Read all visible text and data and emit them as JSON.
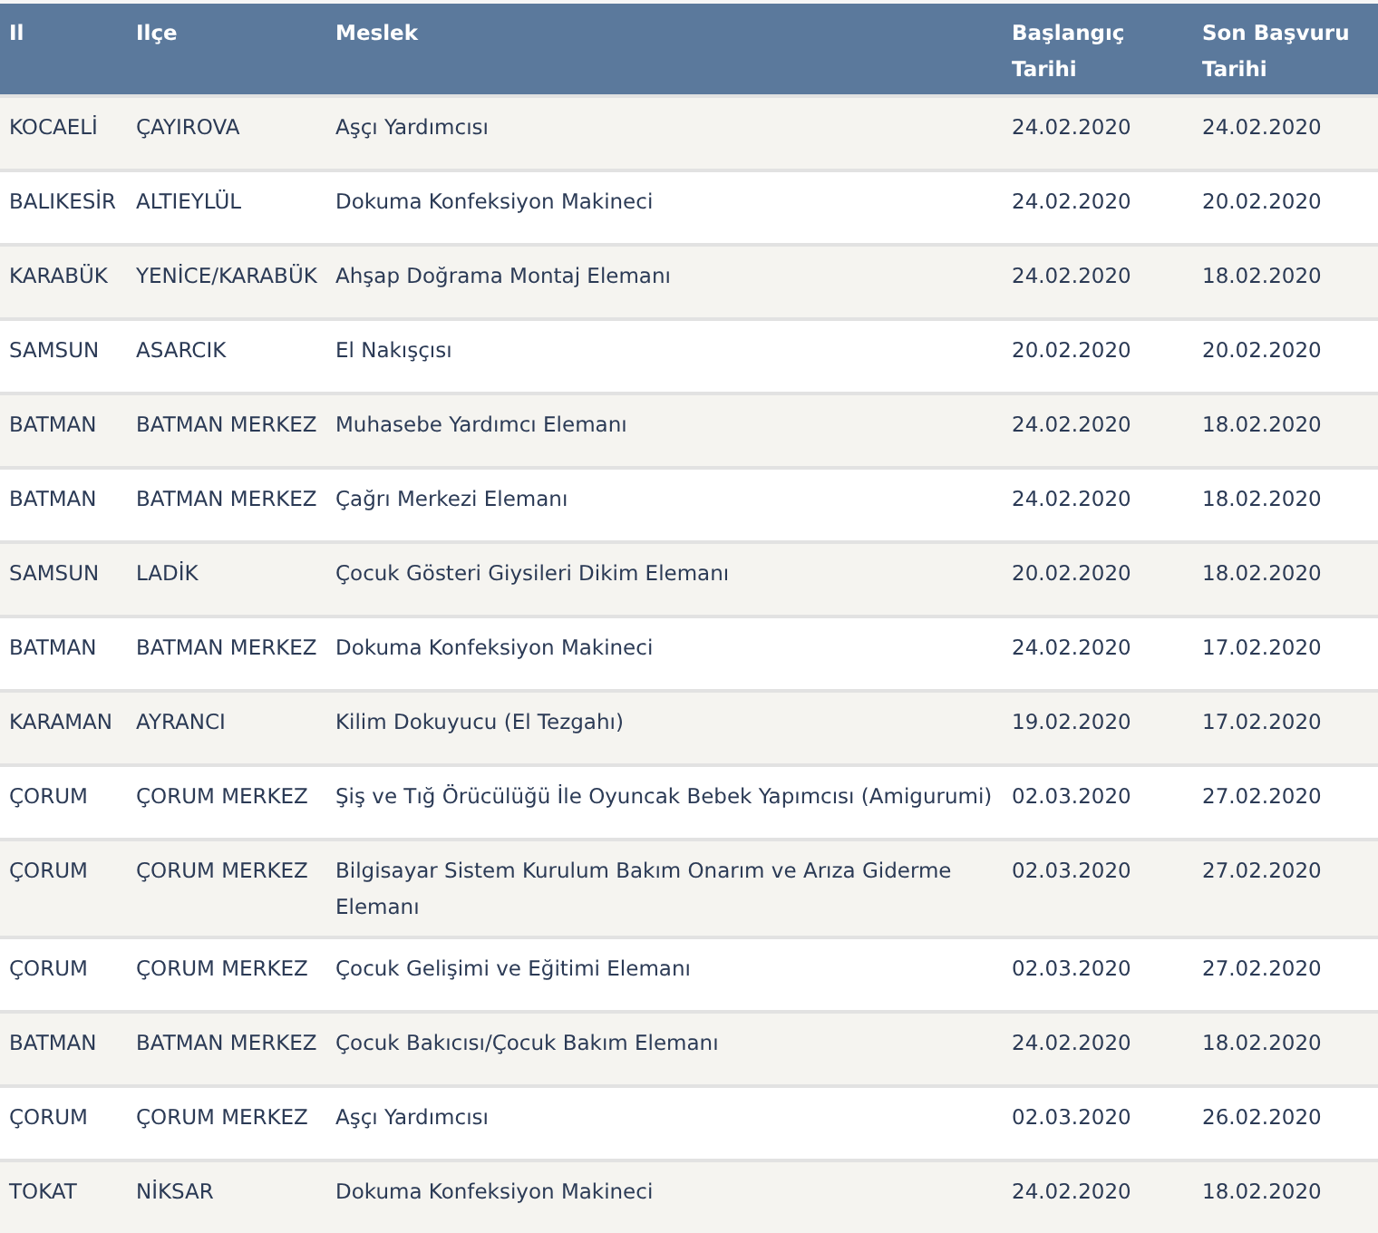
{
  "table": {
    "columns": [
      "Il",
      "Ilçe",
      "Meslek",
      "Başlangıç Tarihi",
      "Son Başvuru Tarihi"
    ],
    "rows": [
      [
        "KOCAELİ",
        "ÇAYIROVA",
        "Aşçı Yardımcısı",
        "24.02.2020",
        "24.02.2020"
      ],
      [
        "BALIKESİR",
        "ALTIEYLÜL",
        "Dokuma Konfeksiyon Makineci",
        "24.02.2020",
        "20.02.2020"
      ],
      [
        "KARABÜK",
        "YENİCE/KARABÜK",
        "Ahşap Doğrama Montaj Elemanı",
        "24.02.2020",
        "18.02.2020"
      ],
      [
        "SAMSUN",
        "ASARCIK",
        "El Nakışçısı",
        "20.02.2020",
        "20.02.2020"
      ],
      [
        "BATMAN",
        "BATMAN MERKEZ",
        "Muhasebe Yardımcı Elemanı",
        "24.02.2020",
        "18.02.2020"
      ],
      [
        "BATMAN",
        "BATMAN MERKEZ",
        "Çağrı Merkezi Elemanı",
        "24.02.2020",
        "18.02.2020"
      ],
      [
        "SAMSUN",
        "LADİK",
        "Çocuk Gösteri Giysileri Dikim Elemanı",
        "20.02.2020",
        "18.02.2020"
      ],
      [
        "BATMAN",
        "BATMAN MERKEZ",
        "Dokuma Konfeksiyon Makineci",
        "24.02.2020",
        "17.02.2020"
      ],
      [
        "KARAMAN",
        "AYRANCI",
        "Kilim Dokuyucu (El Tezgahı)",
        "19.02.2020",
        "17.02.2020"
      ],
      [
        "ÇORUM",
        "ÇORUM MERKEZ",
        "Şiş ve Tığ Örücülüğü İle Oyuncak Bebek Yapımcısı (Amigurumi)",
        "02.03.2020",
        "27.02.2020"
      ],
      [
        "ÇORUM",
        "ÇORUM MERKEZ",
        "Bilgisayar Sistem Kurulum Bakım Onarım ve Arıza Giderme Elemanı",
        "02.03.2020",
        "27.02.2020"
      ],
      [
        "ÇORUM",
        "ÇORUM MERKEZ",
        "Çocuk Gelişimi ve Eğitimi Elemanı",
        "02.03.2020",
        "27.02.2020"
      ],
      [
        "BATMAN",
        "BATMAN MERKEZ",
        "Çocuk Bakıcısı/Çocuk Bakım Elemanı",
        "24.02.2020",
        "18.02.2020"
      ],
      [
        "ÇORUM",
        "ÇORUM MERKEZ",
        "Aşçı Yardımcısı",
        "02.03.2020",
        "26.02.2020"
      ],
      [
        "TOKAT",
        "NİKSAR",
        "Dokuma Konfeksiyon Makineci",
        "24.02.2020",
        "18.02.2020"
      ]
    ]
  }
}
